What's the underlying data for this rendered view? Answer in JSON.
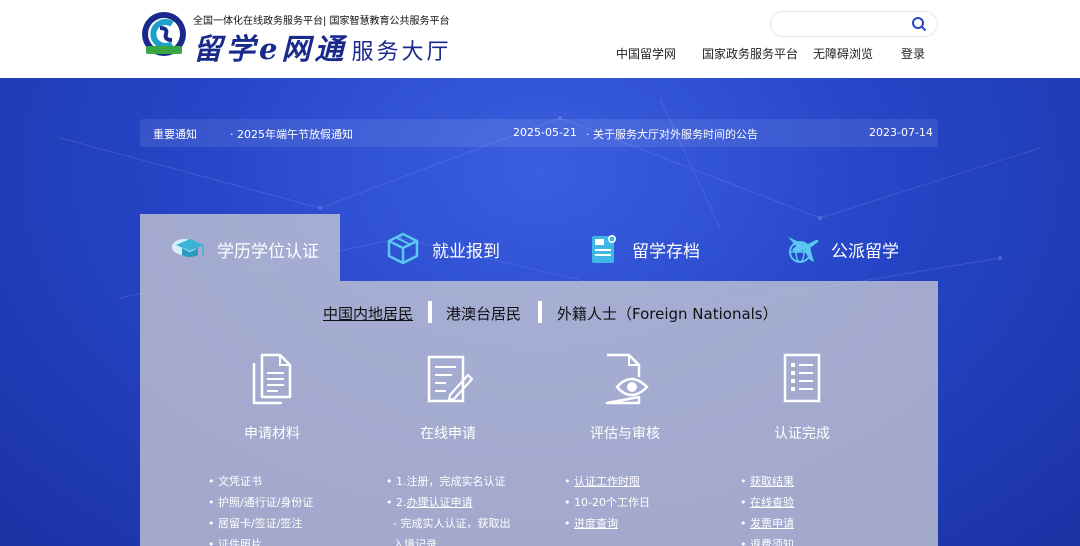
{
  "header": {
    "logo_top": "全国一体化在线政务服务平台| 国家智慧教育公共服务平台",
    "logo_main": "留学e网通",
    "logo_sub": "服务大厅",
    "search_placeholder": "",
    "nav": [
      "中国留学网",
      "国家政务服务平台",
      "无障碍浏览",
      "登录"
    ]
  },
  "notices": {
    "label": "重要通知",
    "items": [
      {
        "text": "2025年端午节放假通知",
        "date": "2025-05-21"
      },
      {
        "text": "关于服务大厅对外服务时间的公告",
        "date": "2023-07-14"
      }
    ]
  },
  "tabs": [
    {
      "label": "学历学位认证",
      "icon": "graduation-cap-icon",
      "active": true
    },
    {
      "label": "就业报到",
      "icon": "cube-icon",
      "active": false
    },
    {
      "label": "留学存档",
      "icon": "archive-icon",
      "active": false
    },
    {
      "label": "公派留学",
      "icon": "plane-globe-icon",
      "active": false
    }
  ],
  "residency": [
    "中国内地居民",
    "港澳台居民",
    "外籍人士（Foreign Nationals）"
  ],
  "steps": [
    {
      "label": "申请材料",
      "icon": "documents-icon"
    },
    {
      "label": "在线申请",
      "icon": "form-edit-icon"
    },
    {
      "label": "评估与审核",
      "icon": "doc-eye-icon"
    },
    {
      "label": "认证完成",
      "icon": "checklist-icon"
    }
  ],
  "details": {
    "col1": [
      "文凭证书",
      "护照/通行证/身份证",
      "居留卡/签证/签注",
      "证件照片"
    ],
    "col2": [
      "1.注册，完成实名认证",
      "2.",
      "办理认证申请",
      "- 完成实人认证，获取出",
      "入境记录"
    ],
    "col3": [
      "认证工作时限",
      "10-20个工作日",
      "进度查询"
    ],
    "col4": [
      "获取结果",
      "在线查验",
      "发票申请",
      "退费须知"
    ]
  },
  "colors": {
    "brand": "#1a2a8c",
    "hero": "#2646c8",
    "accent": "#1fa0c8"
  }
}
